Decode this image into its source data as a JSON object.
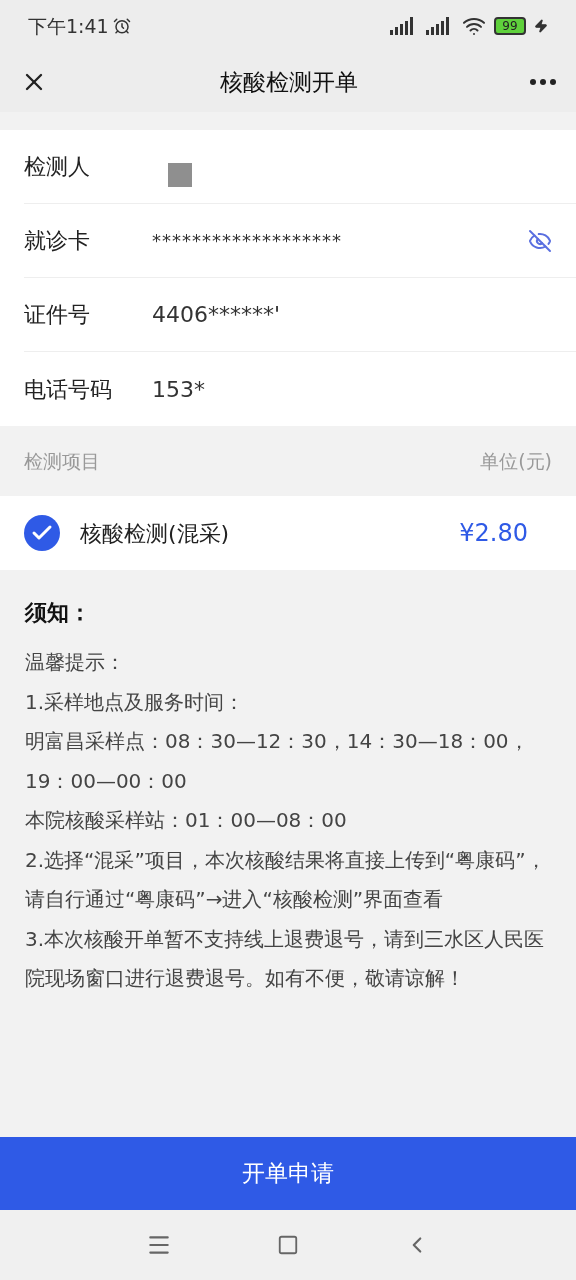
{
  "status_bar": {
    "time": "下午1:41",
    "battery": "99"
  },
  "header": {
    "title": "核酸检测开单"
  },
  "form": [
    {
      "label": "检测人",
      "kind": "redacted"
    },
    {
      "label": "就诊卡",
      "kind": "masked",
      "value": "*******************"
    },
    {
      "label": "证件号",
      "kind": "text",
      "value": "4406******'"
    },
    {
      "label": "电话号码",
      "kind": "text",
      "value": "153*"
    }
  ],
  "items_header": {
    "column_1": "检测项目",
    "column_2": "单位(元)"
  },
  "items": [
    {
      "name": "核酸检测(混采)",
      "price": "¥2.80",
      "checked": true
    }
  ],
  "notice": {
    "title": "须知：",
    "lines": [
      "温馨提示：",
      "1.采样地点及服务时间：",
      "明富昌采样点：08：30—12：30，14：30—18：00，19：00—00：00",
      "本院核酸采样站：01：00—08：00",
      "2.选择“混采”项目，本次核酸结果将直接上传到“粤康码”，请自行通过“粤康码”→进入“核酸检测”界面查看",
      "3.本次核酸开单暂不支持线上退费退号，请到三水区人民医院现场窗口进行退费退号。如有不便，敬请谅解！"
    ]
  },
  "submit_button": "开单申请"
}
